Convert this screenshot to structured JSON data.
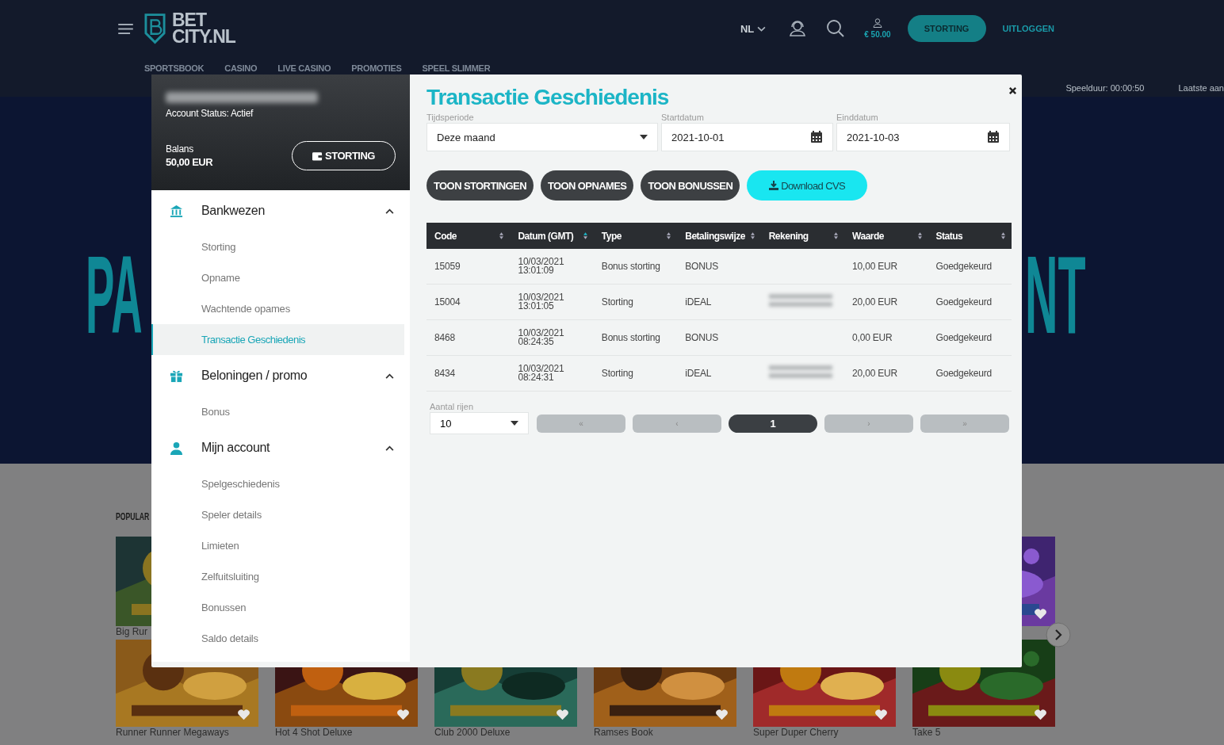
{
  "header": {
    "logo": {
      "line1": "BET",
      "line2": "CITY.NL"
    },
    "language": "NL",
    "balance": "€ 50.00",
    "deposit_button": "STORTING",
    "logout_link": "UITLOGGEN"
  },
  "nav": [
    "SPORTSBOOK",
    "CASINO",
    "LIVE CASINO",
    "PROMOTIES",
    "SPEEL SLIMMER"
  ],
  "session": {
    "play_time": "Speelduur: 00:00:50",
    "last_login": "Laatste aan"
  },
  "hero": {
    "left": "PA",
    "right": "NT"
  },
  "games": {
    "title": "POPULAR",
    "top_row": [
      {
        "kind": "picture",
        "name": "Big Rur"
      },
      {
        "kind": "picture"
      }
    ],
    "bottom_row": [
      {
        "name": "Runner Runner Megaways"
      },
      {
        "name": "Hot 4 Shot Deluxe"
      },
      {
        "name": "Club 2000 Deluxe"
      },
      {
        "name": "Ramses Book"
      },
      {
        "name": "Super Duper Cherry"
      },
      {
        "name": "Take 5"
      }
    ]
  },
  "account": {
    "status": "Account Status: Actief",
    "balance_label": "Balans",
    "balance": "50,00 EUR",
    "deposit_button": "STORTING"
  },
  "menu": [
    {
      "label": "Bankwezen",
      "kind": "bank",
      "expanded": true,
      "children": [
        {
          "label": "Storting",
          "selected": false
        },
        {
          "label": "Opname",
          "selected": false
        },
        {
          "label": "Wachtende opames",
          "selected": false
        },
        {
          "label": "Transactie Geschiedenis",
          "selected": true
        }
      ]
    },
    {
      "label": "Beloningen / promo",
      "kind": "gift",
      "expanded": true,
      "children": [
        {
          "label": "Bonus",
          "selected": false
        }
      ]
    },
    {
      "label": "Mijn account",
      "kind": "person",
      "expanded": true,
      "children": [
        {
          "label": "Spelgeschiedenis",
          "selected": false
        },
        {
          "label": "Speler details",
          "selected": false
        },
        {
          "label": "Limieten",
          "selected": false
        },
        {
          "label": "Zelfuitsluiting",
          "selected": false
        },
        {
          "label": "Bonussen",
          "selected": false
        },
        {
          "label": "Saldo details",
          "selected": false
        }
      ]
    }
  ],
  "panel": {
    "title": "Transactie Geschiedenis",
    "fields": [
      {
        "label": "Tijdsperiode",
        "value": "Deze maand",
        "kind": "select"
      },
      {
        "label": "Startdatum",
        "value": "2021-10-01",
        "kind": "date"
      },
      {
        "label": "Einddatum",
        "value": "2021-10-03",
        "kind": "date"
      }
    ],
    "buttons": [
      {
        "label": "TOON STORTINGEN",
        "kind": "filter"
      },
      {
        "label": "TOON OPNAMES",
        "kind": "filter"
      },
      {
        "label": "TOON BONUSSEN",
        "kind": "filter"
      },
      {
        "label": "Download CVS",
        "kind": "download"
      }
    ],
    "table": {
      "columns": [
        {
          "label": "Code",
          "sorted": false
        },
        {
          "label": "Datum (GMT)",
          "sorted": true
        },
        {
          "label": "Type",
          "sorted": false
        },
        {
          "label": "Betalingswijze",
          "sorted": false
        },
        {
          "label": "Rekening",
          "sorted": false
        },
        {
          "label": "Waarde",
          "sorted": false
        },
        {
          "label": "Status",
          "sorted": false
        }
      ],
      "rows": [
        {
          "code": "15059",
          "date": "10/03/2021",
          "time": "13:01:09",
          "type": "Bonus storting",
          "method": "BONUS",
          "account_blurred": false,
          "amount": "10,00 EUR",
          "status": "Goedgekeurd"
        },
        {
          "code": "15004",
          "date": "10/03/2021",
          "time": "13:01:05",
          "type": "Storting",
          "method": "iDEAL",
          "account_blurred": true,
          "amount": "20,00 EUR",
          "status": "Goedgekeurd"
        },
        {
          "code": "8468",
          "date": "10/03/2021",
          "time": "08:24:35",
          "type": "Bonus storting",
          "method": "BONUS",
          "account_blurred": false,
          "amount": "0,00 EUR",
          "status": "Goedgekeurd"
        },
        {
          "code": "8434",
          "date": "10/03/2021",
          "time": "08:24:31",
          "type": "Storting",
          "method": "iDEAL",
          "account_blurred": true,
          "amount": "20,00 EUR",
          "status": "Goedgekeurd"
        }
      ]
    },
    "pagination": {
      "rows_label": "Aantal rijen",
      "rows_value": "10",
      "pages": [
        {
          "label": "«",
          "selected": false
        },
        {
          "label": "‹",
          "selected": false
        },
        {
          "label": "1",
          "selected": true
        },
        {
          "label": "›",
          "selected": false
        },
        {
          "label": "»",
          "selected": false
        }
      ]
    }
  }
}
